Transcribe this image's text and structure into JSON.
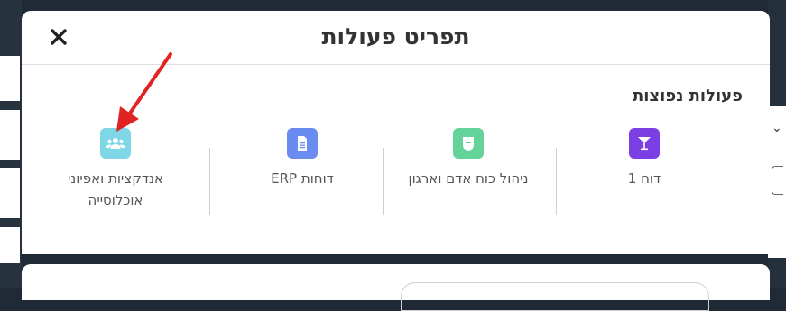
{
  "modal": {
    "title": "תפריט פעולות",
    "close_icon": "close-icon",
    "section_title": "פעולות נפוצות",
    "actions": [
      {
        "label": "דוח 1",
        "icon": "cocktail-glass-icon",
        "color": "#7b3fe4"
      },
      {
        "label": "ניהול כוח אדם וארגון",
        "icon": "badge-icon",
        "color": "#64d39a"
      },
      {
        "label": "דוחות ERP",
        "icon": "document-icon",
        "color": "#6a8bf0"
      },
      {
        "label": "אנדקציות ואפיוני אוכלוסייה",
        "icon": "users-icon",
        "color": "#7ed6e6"
      }
    ]
  },
  "annotation": {
    "color": "#e02424",
    "icon": "red-arrow-icon"
  }
}
